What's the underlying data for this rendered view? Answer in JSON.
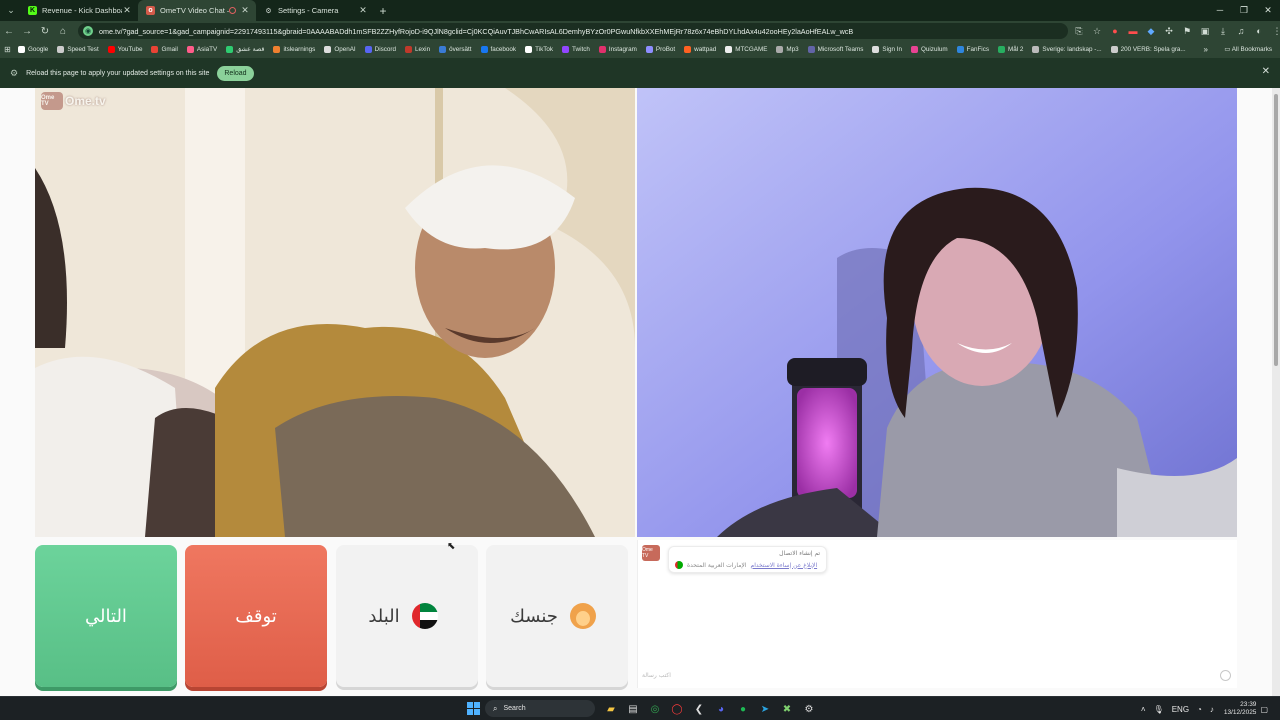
{
  "tabs": [
    {
      "title": "Revenue - Kick Dashboard",
      "icon": "kick-icon",
      "color": "#53fc18",
      "active": false
    },
    {
      "title": "OmeTV Video Chat — Omegle",
      "icon": "ometv-icon",
      "color": "#d45a4a",
      "active": true
    },
    {
      "title": "Settings - Camera",
      "icon": "gear-icon",
      "color": "#cfd8d2",
      "active": false
    }
  ],
  "new_tab_label": "+",
  "address_bar": {
    "url": "ome.tv/?gad_source=1&gad_campaignid=22917493115&gbraid=0AAAABADdh1mSFB2ZZHyfRojoD-i9QJlN8gclid=Cj0KCQiAuvTJBhCwARIsAL6DemhyBYzOr0PGwuNfkbXXEhMEjRr78z6x74eBhDYLhdAx4u42ooHEy2laAoHfEALw_wcB"
  },
  "bookmarks": [
    {
      "label": "Google",
      "color": "#ffffff"
    },
    {
      "label": "Speed Test",
      "color": "#cccccc"
    },
    {
      "label": "YouTube",
      "color": "#ff0000"
    },
    {
      "label": "Gmail",
      "color": "#ea4335"
    },
    {
      "label": "AsiaTV",
      "color": "#ff5c8a"
    },
    {
      "label": "قصة عشق",
      "color": "#2ecc71"
    },
    {
      "label": "itslearnings",
      "color": "#f08030"
    },
    {
      "label": "OpenAI",
      "color": "#dddddd"
    },
    {
      "label": "Discord",
      "color": "#5865f2"
    },
    {
      "label": "Lexin",
      "color": "#c0392b"
    },
    {
      "label": "översätt",
      "color": "#3a7bd5"
    },
    {
      "label": "facebook",
      "color": "#1877f2"
    },
    {
      "label": "TikTok",
      "color": "#ffffff"
    },
    {
      "label": "Twitch",
      "color": "#9146ff"
    },
    {
      "label": "Instagram",
      "color": "#e1306c"
    },
    {
      "label": "ProBot",
      "color": "#8e8eff"
    },
    {
      "label": "wattpad",
      "color": "#ff6122"
    },
    {
      "label": "MTCGAME",
      "color": "#eeeeee"
    },
    {
      "label": "Mp3",
      "color": "#aaaaaa"
    },
    {
      "label": "Microsoft Teams",
      "color": "#6264a7"
    },
    {
      "label": "Sign In",
      "color": "#dddddd"
    },
    {
      "label": "Quizulum",
      "color": "#e84393"
    },
    {
      "label": "FanFics",
      "color": "#2e86de"
    },
    {
      "label": "Mål 2",
      "color": "#27ae60"
    },
    {
      "label": "Sverige: landskap -...",
      "color": "#bbbbbb"
    },
    {
      "label": "200 VERB: Spela gra...",
      "color": "#cccccc"
    }
  ],
  "bookmarks_more": "»",
  "all_bookmarks": "All Bookmarks",
  "infobar": {
    "message": "Reload this page to apply your updated settings on this site",
    "reload_label": "Reload"
  },
  "watermark": {
    "text": "Ome.tv",
    "logo": "Ome TV"
  },
  "buttons": {
    "next": "التالي",
    "stop": "توقف",
    "country": "البلد",
    "gender": "جنسك"
  },
  "chat": {
    "avatar_label": "Ome TV",
    "line1": "تم إنشاء الاتصال",
    "report_link": "الإبلاغ عن إساءة الاستخدام",
    "country_name": "الإمارات العربية المتحدة",
    "input_placeholder": "اكتب رسالة"
  },
  "taskbar": {
    "search_label": "Search",
    "language": "ENG",
    "time": "23:39",
    "date": "13/12/2025"
  }
}
